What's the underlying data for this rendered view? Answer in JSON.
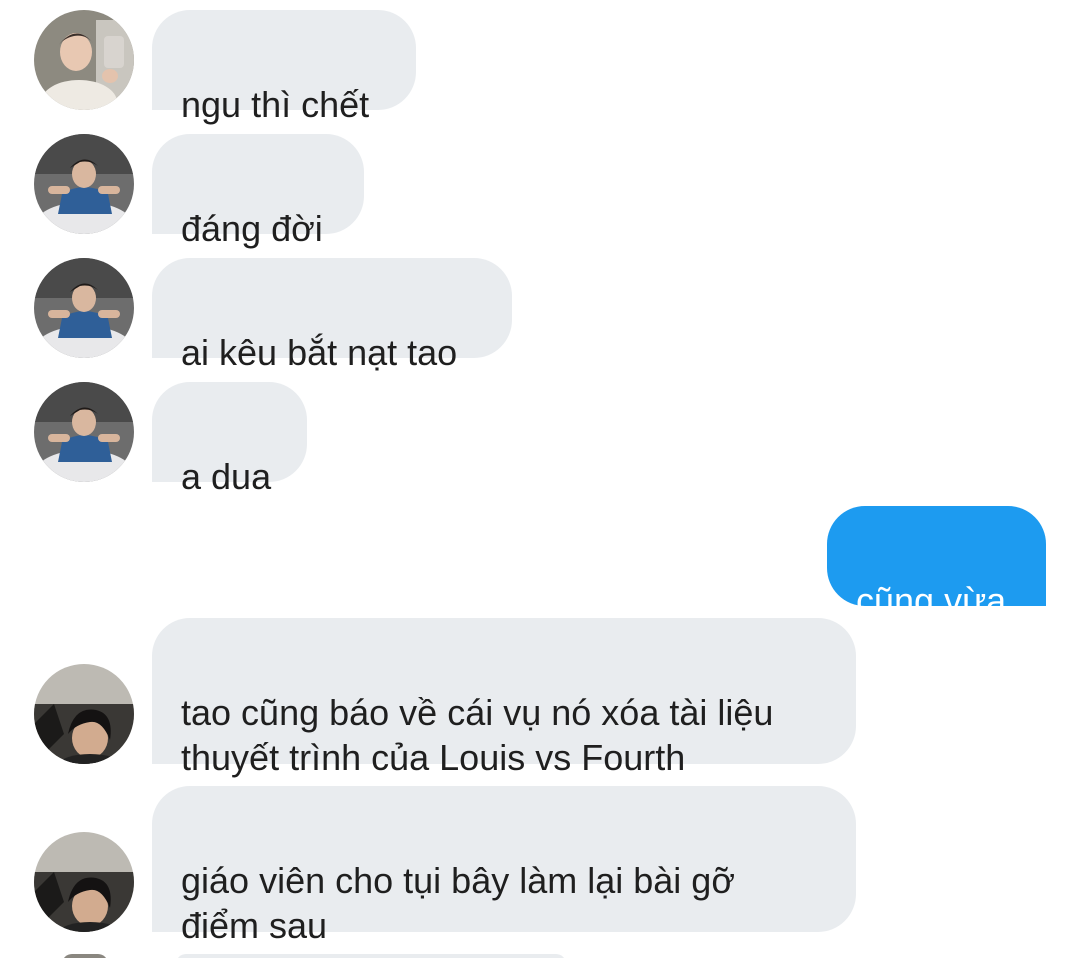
{
  "messages": [
    {
      "from": "other",
      "avatar": "avatar-white-sweater",
      "text": "ngu thì chết"
    },
    {
      "from": "other",
      "avatar": "avatar-blue-shirt",
      "text": "đáng đời"
    },
    {
      "from": "other",
      "avatar": "avatar-blue-shirt",
      "text": "ai kêu bắt nạt tao"
    },
    {
      "from": "other",
      "avatar": "avatar-blue-shirt",
      "text": "a dua"
    },
    {
      "from": "me",
      "text": "cũng vừa"
    },
    {
      "from": "other",
      "avatar": "avatar-dark-hair",
      "text": "tao cũng báo về cái vụ nó xóa tài liệu\nthuyết trình của Louis vs Fourth"
    },
    {
      "from": "other",
      "avatar": "avatar-dark-hair",
      "text": "giáo viên cho tụi bây làm lại bài gỡ\nđiểm sau"
    }
  ],
  "colors": {
    "received_bubble": "#e9ecef",
    "sent_bubble": "#1d9bf0",
    "received_text": "#1f1f1f",
    "sent_text": "#ffffff"
  }
}
